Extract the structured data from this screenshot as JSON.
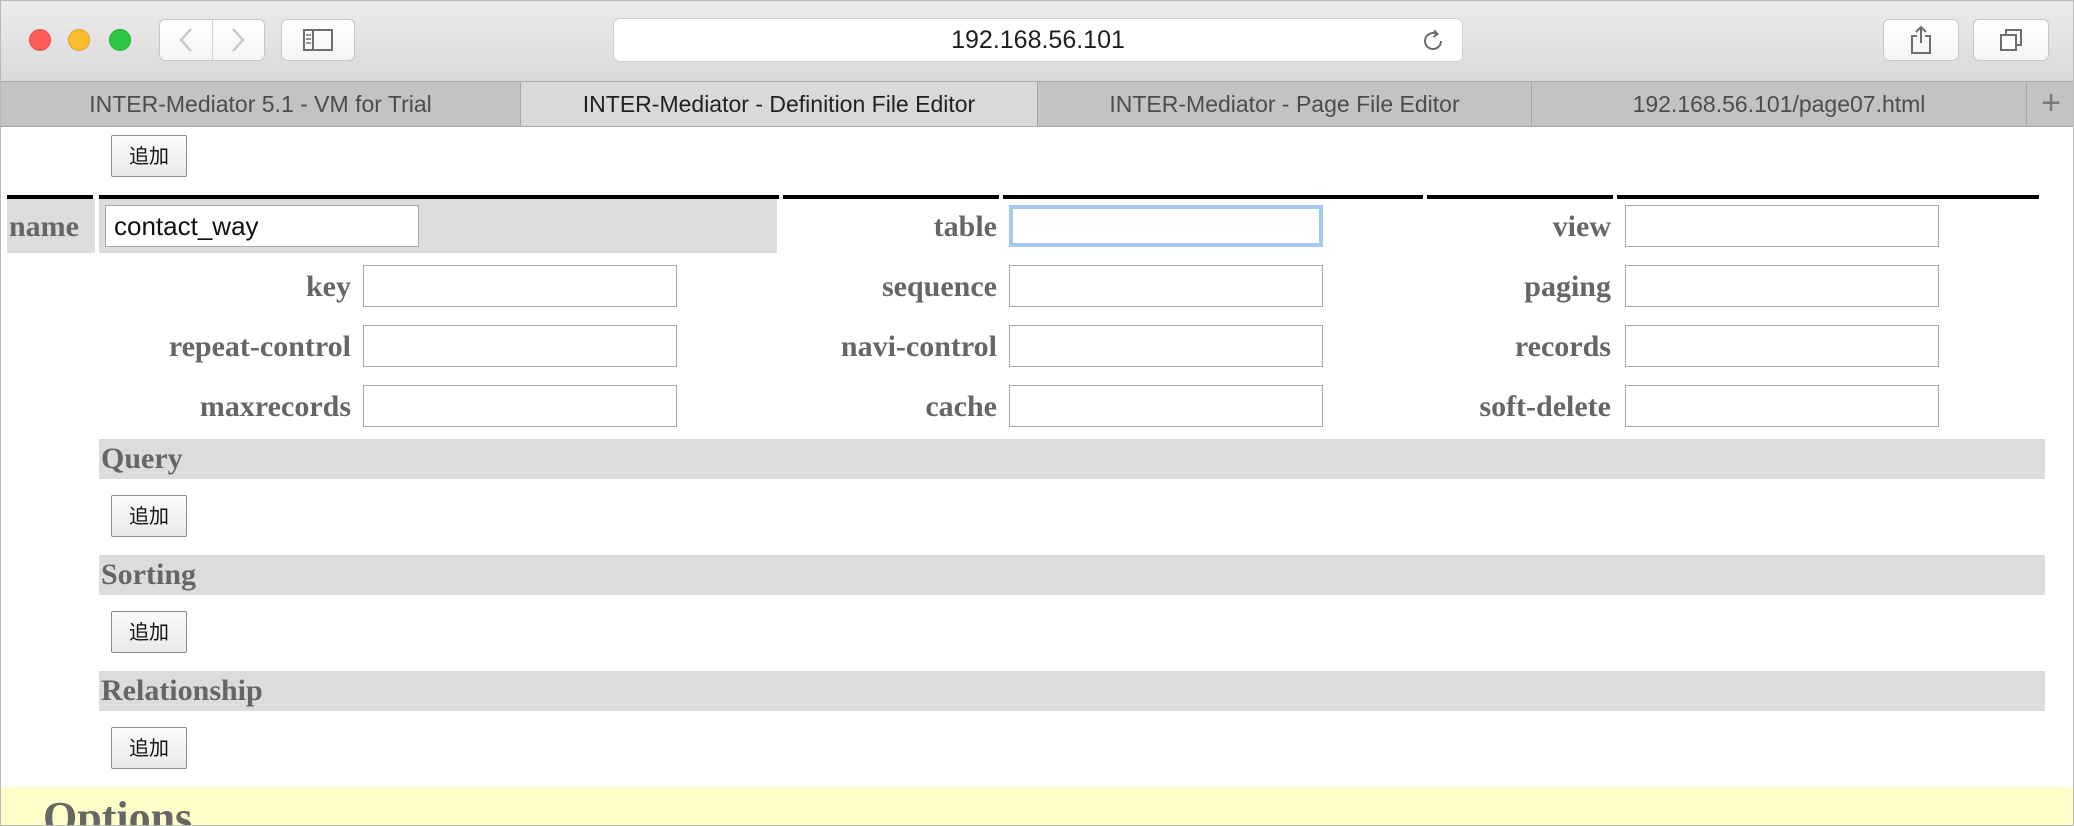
{
  "browser": {
    "url": "192.168.56.101",
    "tabs": [
      {
        "label": "INTER-Mediator 5.1 - VM for Trial",
        "active": false
      },
      {
        "label": "INTER-Mediator - Definition File Editor",
        "active": true
      },
      {
        "label": "INTER-Mediator - Page File Editor",
        "active": false
      },
      {
        "label": "192.168.56.101/page07.html",
        "active": false
      }
    ],
    "new_tab_label": "+"
  },
  "editor": {
    "add_label": "追加",
    "name": {
      "label": "name",
      "value": "contact_way"
    },
    "fields": {
      "table": {
        "label": "table",
        "value": ""
      },
      "view": {
        "label": "view",
        "value": ""
      },
      "key": {
        "label": "key",
        "value": ""
      },
      "sequence": {
        "label": "sequence",
        "value": ""
      },
      "paging": {
        "label": "paging",
        "value": ""
      },
      "repeat_control": {
        "label": "repeat-control",
        "value": ""
      },
      "navi_control": {
        "label": "navi-control",
        "value": ""
      },
      "records": {
        "label": "records",
        "value": ""
      },
      "maxrecords": {
        "label": "maxrecords",
        "value": ""
      },
      "cache": {
        "label": "cache",
        "value": ""
      },
      "soft_delete": {
        "label": "soft-delete",
        "value": ""
      }
    },
    "sections": {
      "query": "Query",
      "sorting": "Sorting",
      "relationship": "Relationship"
    },
    "options_title": "Options"
  },
  "colors": {
    "section_bg": "#dcdcdc",
    "label_text": "#666666",
    "options_bg": "#fffec8",
    "focus_ring": "#a4c8f0"
  }
}
